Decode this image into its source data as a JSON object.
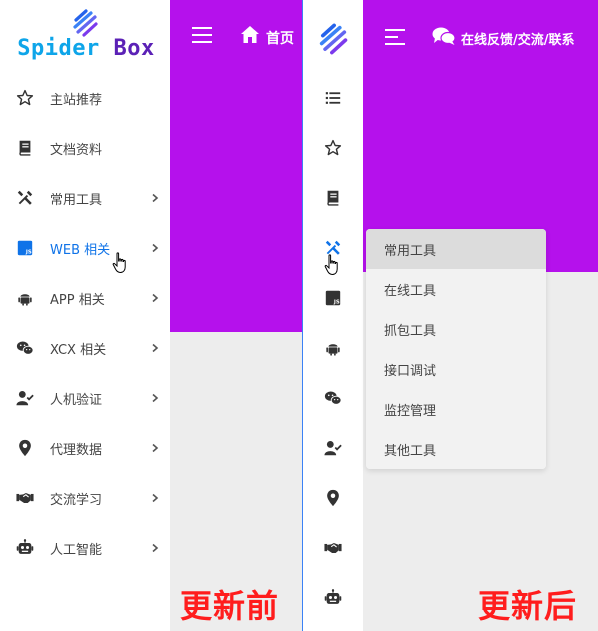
{
  "left": {
    "logo_text": "Spider Box",
    "nav": [
      {
        "label": "主站推荐",
        "icon": "star-outline-icon",
        "chevron": false
      },
      {
        "label": "文档资料",
        "icon": "book-icon",
        "chevron": false
      },
      {
        "label": "常用工具",
        "icon": "tools-icon",
        "chevron": true
      },
      {
        "label": "WEB 相关",
        "icon": "js-icon",
        "chevron": true,
        "active": true
      },
      {
        "label": "APP 相关",
        "icon": "android-icon",
        "chevron": true
      },
      {
        "label": "XCX 相关",
        "icon": "wechat-icon",
        "chevron": true
      },
      {
        "label": "人机验证",
        "icon": "user-check-icon",
        "chevron": true
      },
      {
        "label": "代理数据",
        "icon": "map-marker-icon",
        "chevron": true
      },
      {
        "label": "交流学习",
        "icon": "handshake-icon",
        "chevron": true
      },
      {
        "label": "人工智能",
        "icon": "robot-icon",
        "chevron": true
      }
    ],
    "topbar": {
      "home_label": "首页"
    },
    "caption": "更新前"
  },
  "right": {
    "topbar": {
      "feedback_label": "在线反馈/交流/联系"
    },
    "rail_icons": [
      "list-icon",
      "star-outline-icon",
      "book-icon",
      "tools-icon",
      "js-icon",
      "android-icon",
      "wechat-icon",
      "user-check-icon",
      "map-marker-icon",
      "handshake-icon",
      "robot-icon"
    ],
    "submenu": [
      "常用工具",
      "在线工具",
      "抓包工具",
      "接口调试",
      "监控管理",
      "其他工具"
    ],
    "caption": "更新后"
  },
  "colors": {
    "accent_purple": "#b511ec",
    "active_blue": "#0f73e8",
    "caption_red": "#ff1d1d",
    "divider_blue": "#3b82f6"
  }
}
